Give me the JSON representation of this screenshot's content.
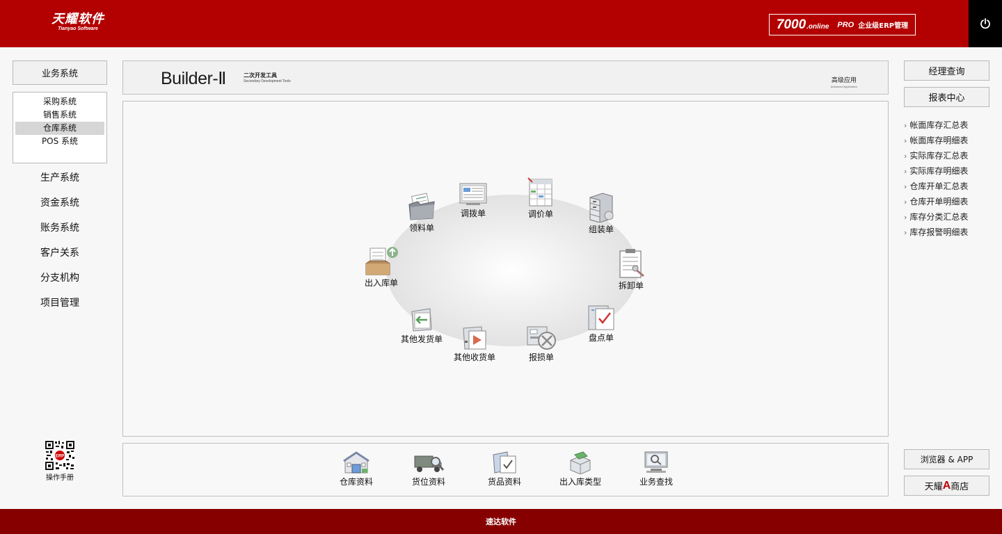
{
  "header": {
    "logo_cn": "天耀软件",
    "logo_en": "Tianyao Software",
    "product_num": "7000",
    "product_online": ".online",
    "product_pro": "PRO",
    "product_desc": "企业级ERP管理",
    "icons": {
      "power": "power-icon"
    }
  },
  "left": {
    "business_label": "业务系统",
    "sub_items": [
      {
        "label": "采购系统",
        "active": false
      },
      {
        "label": "销售系统",
        "active": false
      },
      {
        "label": "仓库系统",
        "active": true
      },
      {
        "label": "POS 系统",
        "active": false
      }
    ],
    "nav_items": [
      "生产系统",
      "资金系统",
      "账务系统",
      "客户关系",
      "分支机构",
      "项目管理"
    ],
    "qr_caption": "操作手册"
  },
  "banner": {
    "title": "Builder-Ⅱ",
    "sub_cn": "二次开发工具",
    "sub_en": "Secondary Development Tools",
    "adv_cn": "高级应用",
    "adv_en": "Advanced Application"
  },
  "wheel": {
    "items": [
      {
        "label": "领料单",
        "icon": "folder-icon"
      },
      {
        "label": "调拨单",
        "icon": "monitor-doc-icon"
      },
      {
        "label": "调价单",
        "icon": "spreadsheet-icon"
      },
      {
        "label": "组装单",
        "icon": "cabinet-icon"
      },
      {
        "label": "出入库单",
        "icon": "inbox-icon"
      },
      {
        "label": "拆卸单",
        "icon": "clipboard-icon"
      },
      {
        "label": "其他发货单",
        "icon": "doc-arrow-icon"
      },
      {
        "label": "盘点单",
        "icon": "check-doc-icon"
      },
      {
        "label": "其他收货单",
        "icon": "receive-doc-icon"
      },
      {
        "label": "报损单",
        "icon": "damage-icon"
      }
    ]
  },
  "bottom": {
    "items": [
      {
        "label": "仓库资料",
        "icon": "warehouse-icon"
      },
      {
        "label": "货位资料",
        "icon": "truck-search-icon"
      },
      {
        "label": "货品资料",
        "icon": "goods-doc-icon"
      },
      {
        "label": "出入库类型",
        "icon": "box-type-icon"
      },
      {
        "label": "业务查找",
        "icon": "computer-search-icon"
      }
    ]
  },
  "right": {
    "manager_query": "经理查询",
    "report_center": "报表中心",
    "reports": [
      "帐面库存汇总表",
      "帐面库存明细表",
      "实际库存汇总表",
      "实际库存明细表",
      "仓库开单汇总表",
      "仓库开单明细表",
      "库存分类汇总表",
      "库存报警明细表"
    ],
    "browser_app": "浏览器 & APP",
    "store_prefix": "天耀",
    "store_a": "A",
    "store_suffix": "商店"
  },
  "footer": {
    "text": "速达软件"
  }
}
